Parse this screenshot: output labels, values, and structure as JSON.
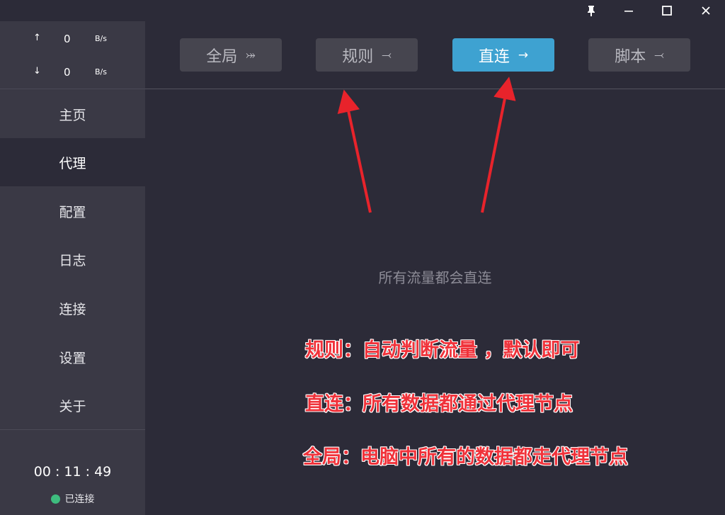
{
  "window": {
    "pin_icon": "pin-icon",
    "minimize_icon": "minimize-icon",
    "maximize_icon": "maximize-icon",
    "close_icon": "close-icon"
  },
  "traffic": {
    "upload": {
      "arrow": "↑",
      "value": "0",
      "unit": "B/s"
    },
    "download": {
      "arrow": "↓",
      "value": "0",
      "unit": "B/s"
    }
  },
  "sidebar": {
    "items": [
      {
        "label": "主页"
      },
      {
        "label": "代理",
        "active": true
      },
      {
        "label": "配置"
      },
      {
        "label": "日志"
      },
      {
        "label": "连接"
      },
      {
        "label": "设置"
      },
      {
        "label": "关于"
      }
    ],
    "timer": "00 : 11 : 49",
    "status": "已连接",
    "status_color": "#3ebd7f"
  },
  "modes": [
    {
      "label": "全局",
      "icon": "⤖",
      "icon_name": "global-route-icon"
    },
    {
      "label": "规则",
      "icon": "⤙",
      "icon_name": "rule-route-icon"
    },
    {
      "label": "直连",
      "icon": "→",
      "icon_name": "direct-arrow-icon",
      "active": true
    },
    {
      "label": "脚本",
      "icon": "⤙",
      "icon_name": "script-route-icon"
    }
  ],
  "main": {
    "mode_description": "所有流量都会直连"
  },
  "annotations": [
    "规则：自动判断流量 ，默认即可",
    "直连：所有数据都通过代理节点",
    "全局：电脑中所有的数据都走代理节点"
  ],
  "colors": {
    "accent": "#3ea2d1",
    "annotation": "#f0323a",
    "background": "#2c2b38",
    "sidebar": "#3a3945"
  }
}
